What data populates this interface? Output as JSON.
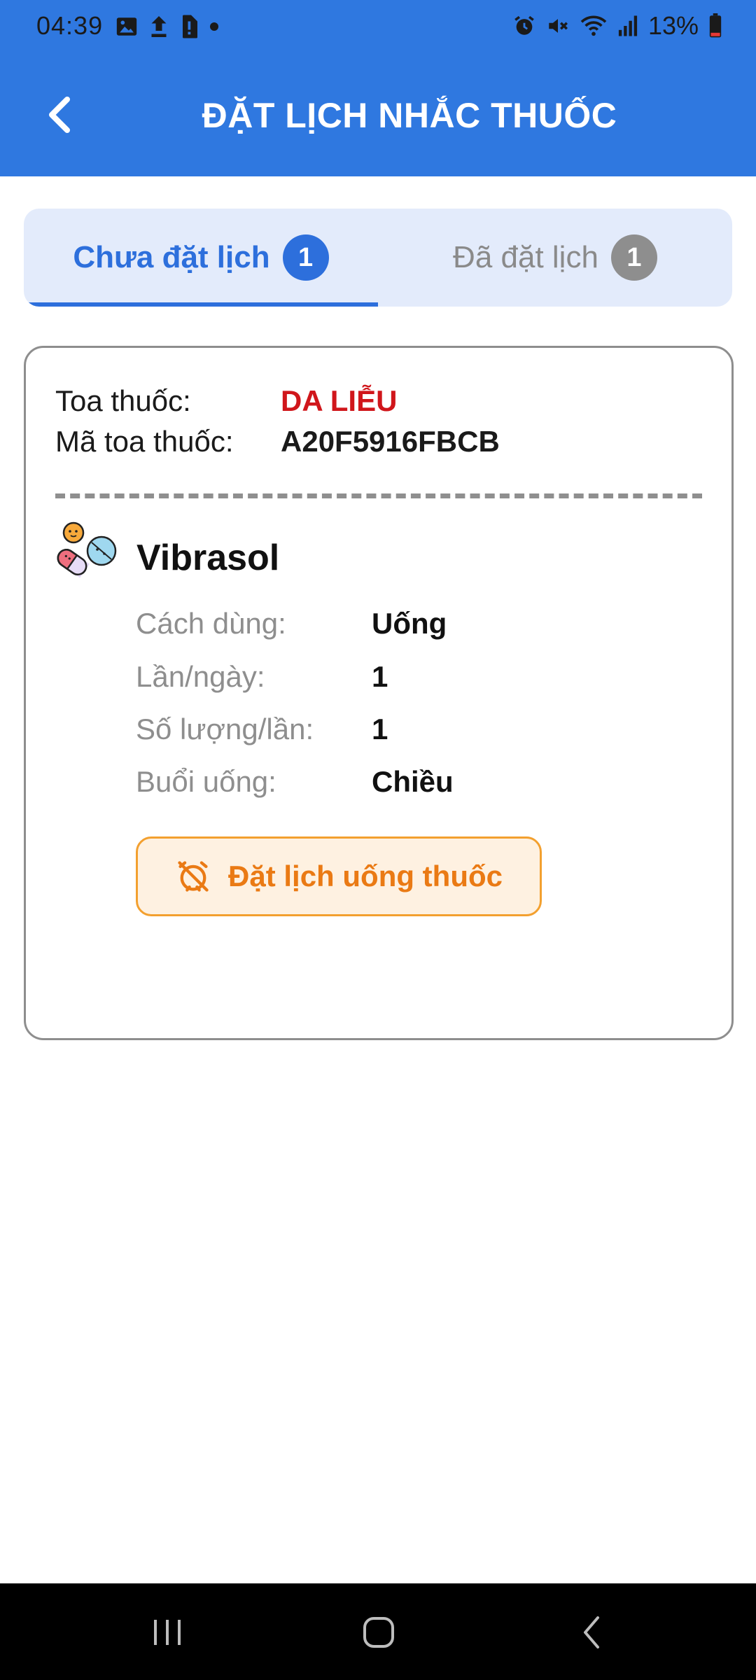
{
  "status_bar": {
    "time": "04:39",
    "battery": "13%",
    "left_icons": [
      "image-icon",
      "upload-icon",
      "sim-icon",
      "dot-icon"
    ],
    "right_icons": [
      "alarm-icon",
      "mute-icon",
      "wifi-icon",
      "signal-icon",
      "battery-icon"
    ]
  },
  "header": {
    "title": "ĐẶT LỊCH NHẮC THUỐC",
    "back_icon": "chevron-left-icon"
  },
  "tabs": [
    {
      "label": "Chưa đặt lịch",
      "count": "1",
      "active": true
    },
    {
      "label": "Đã đặt lịch",
      "count": "1",
      "active": false
    }
  ],
  "prescription": {
    "type_label": "Toa thuốc:",
    "type_value": "DA LIỄU",
    "code_label": "Mã toa thuốc:",
    "code_value": "A20F5916FBCB",
    "medicine": {
      "icon": "pills-icon",
      "name": "Vibrasol",
      "details": [
        {
          "label": "Cách dùng:",
          "value": "Uống"
        },
        {
          "label": "Lần/ngày:",
          "value": "1"
        },
        {
          "label": "Số lượng/lần:",
          "value": "1"
        },
        {
          "label": "Buổi uống:",
          "value": "Chiều"
        }
      ],
      "action_label": "Đặt lịch uống thuốc",
      "action_icon": "alarm-off-icon"
    }
  },
  "colors": {
    "header_bg": "#2f78e0",
    "accent_blue": "#2d6fdc",
    "tab_bg": "#e3ebfb",
    "red_value": "#d0161b",
    "orange_button_text": "#ea7a14",
    "orange_button_border": "#f3a02f",
    "orange_button_bg": "#fef1e1"
  }
}
